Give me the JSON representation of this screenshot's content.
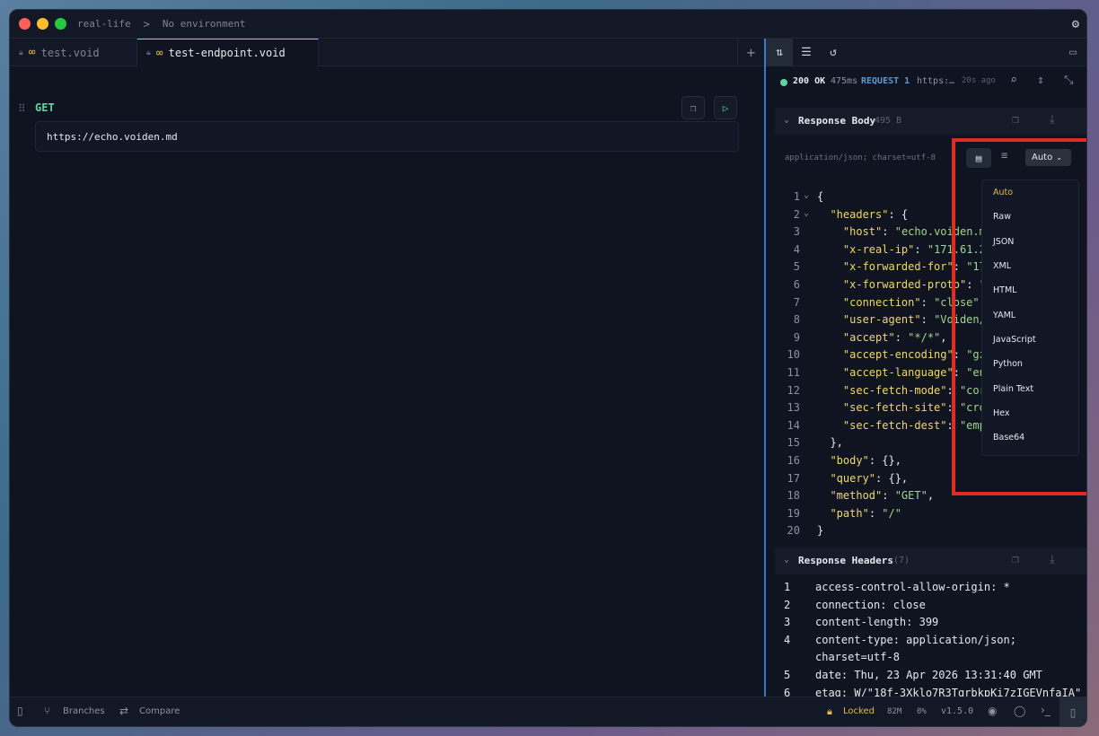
{
  "titlebar": {
    "project": "real-life",
    "separator": ">",
    "environment": "No environment",
    "settings_icon": "gear-icon"
  },
  "tabs": [
    {
      "label": "test.void",
      "active": false
    },
    {
      "label": "test-endpoint.void",
      "active": true
    }
  ],
  "tab_add_label": "+",
  "editor": {
    "method": "GET",
    "url": "https://echo.voiden.md"
  },
  "right_toolbar": {
    "icons": [
      "sort-icon",
      "list-icon",
      "history-icon",
      "panel-icon"
    ]
  },
  "status": {
    "code": "200 OK",
    "time": "475ms",
    "request": "REQUEST 1",
    "url": "https:…",
    "ago": "20s ago"
  },
  "response_body": {
    "title": "Response Body",
    "size": "495 B",
    "content_type": "application/json; charset=utf-8",
    "format_selected": "Auto"
  },
  "format_options": [
    "Auto",
    "Raw",
    "JSON",
    "XML",
    "HTML",
    "YAML",
    "JavaScript",
    "Python",
    "Plain Text",
    "Hex",
    "Base64"
  ],
  "body_lines": [
    {
      "n": "1",
      "fold": "⌄",
      "text": "{"
    },
    {
      "n": "2",
      "fold": "⌄",
      "text": "  \"headers\": {"
    },
    {
      "n": "3",
      "fold": "",
      "text": "    \"host\": \"echo.voiden.md\","
    },
    {
      "n": "4",
      "fold": "",
      "text": "    \"x-real-ip\": \"171.61.24"
    },
    {
      "n": "5",
      "fold": "",
      "text": "    \"x-forwarded-for\": \"171"
    },
    {
      "n": "6",
      "fold": "",
      "text": "    \"x-forwarded-proto\": \"h"
    },
    {
      "n": "7",
      "fold": "",
      "text": "    \"connection\": \"close\","
    },
    {
      "n": "8",
      "fold": "",
      "text": "    \"user-agent\": \"Voiden/1"
    },
    {
      "n": "9",
      "fold": "",
      "text": "    \"accept\": \"*/*\","
    },
    {
      "n": "10",
      "fold": "",
      "text": "    \"accept-encoding\": \"gzi"
    },
    {
      "n": "11",
      "fold": "",
      "text": "    \"accept-language\": \"en-"
    },
    {
      "n": "12",
      "fold": "",
      "text": "    \"sec-fetch-mode\": \"cors"
    },
    {
      "n": "13",
      "fold": "",
      "text": "    \"sec-fetch-site\": \"cros"
    },
    {
      "n": "14",
      "fold": "",
      "text": "    \"sec-fetch-dest\": \"empt"
    },
    {
      "n": "15",
      "fold": "",
      "text": "  },"
    },
    {
      "n": "16",
      "fold": "",
      "text": "  \"body\": {},"
    },
    {
      "n": "17",
      "fold": "",
      "text": "  \"query\": {},"
    },
    {
      "n": "18",
      "fold": "",
      "text": "  \"method\": \"GET\","
    },
    {
      "n": "19",
      "fold": "",
      "text": "  \"path\": \"/\""
    },
    {
      "n": "20",
      "fold": "",
      "text": "}"
    }
  ],
  "response_headers": {
    "title": "Response Headers",
    "count": "(7)",
    "lines": [
      {
        "n": "1",
        "text": "access-control-allow-origin: *"
      },
      {
        "n": "2",
        "text": "connection: close"
      },
      {
        "n": "3",
        "text": "content-length: 399"
      },
      {
        "n": "4",
        "text": "content-type: application/json;"
      },
      {
        "n": "",
        "text": "charset=utf-8"
      },
      {
        "n": "5",
        "text": "date: Thu, 23 Apr 2026 13:31:40 GMT"
      },
      {
        "n": "6",
        "text": "etag: W/\"18f-3Xklo7R3TgrbkpKi7zIGEVnfaIA\""
      }
    ]
  },
  "bottombar": {
    "branches": "Branches",
    "compare": "Compare",
    "locked": "Locked",
    "memory": "82M",
    "cpu": "0%",
    "version": "v1.5.0"
  },
  "colors": {
    "accent": "#e5b94e",
    "success": "#5fd3a0",
    "highlight": "#e22b22",
    "link": "#3a78c8"
  }
}
